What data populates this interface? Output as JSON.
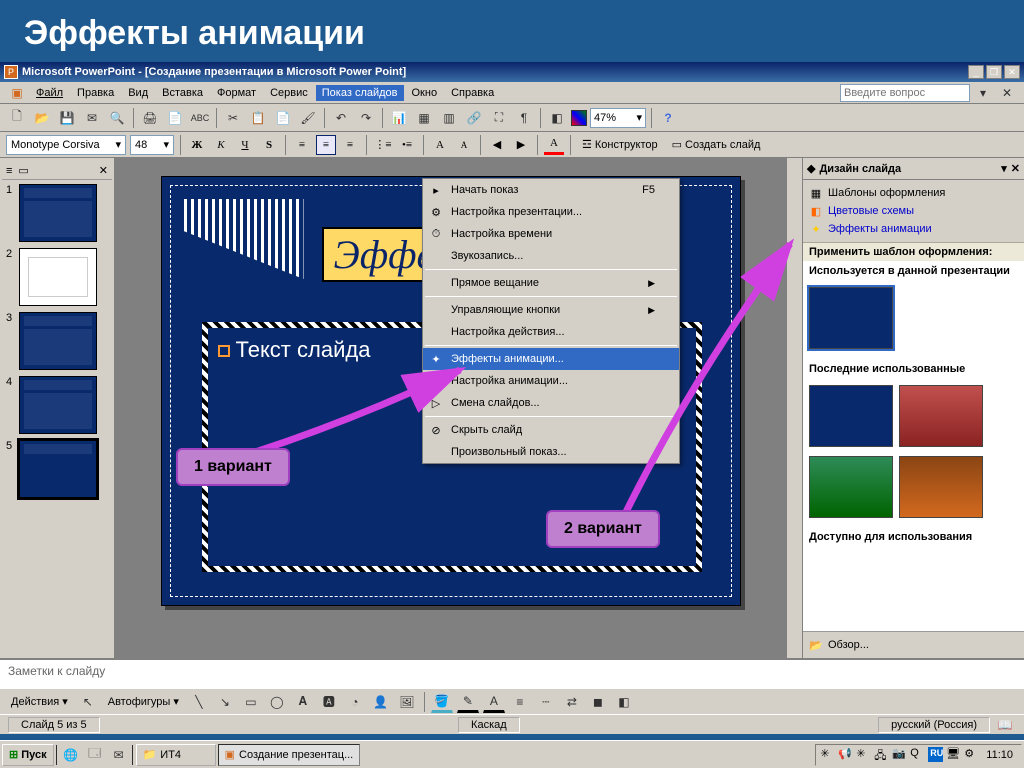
{
  "page_heading": "Эффекты анимации",
  "titlebar": "Microsoft PowerPoint - [Создание презентации в Microsoft Power Point]",
  "menu": {
    "file": "Файл",
    "edit": "Правка",
    "view": "Вид",
    "insert": "Вставка",
    "format": "Формат",
    "tools": "Сервис",
    "slideshow": "Показ слайдов",
    "window": "Окно",
    "help": "Справка"
  },
  "help_placeholder": "Введите вопрос",
  "zoom": "47%",
  "font": {
    "name": "Monotype Corsiva",
    "size": "48"
  },
  "toolbar2": {
    "designer": "Конструктор",
    "new_slide": "Создать слайд"
  },
  "dropdown": {
    "start": "Начать показ",
    "start_kbd": "F5",
    "setup": "Настройка презентации...",
    "rehearse": "Настройка времени",
    "record": "Звукозапись...",
    "broadcast": "Прямое вещание",
    "actionbtn": "Управляющие кнопки",
    "actionset": "Настройка действия...",
    "animscheme": "Эффекты анимации...",
    "customanim": "Настройка анимации...",
    "transition": "Смена слайдов...",
    "hide": "Скрыть слайд",
    "customshow": "Произвольный показ..."
  },
  "slide": {
    "title_frag": "Эффе",
    "body": "Текст слайда"
  },
  "callouts": {
    "v1": "1 вариант",
    "v2": "2 вариант"
  },
  "taskpane": {
    "title": "Дизайн слайда",
    "templates": "Шаблоны оформления",
    "colors": "Цветовые схемы",
    "anim": "Эффекты анимации",
    "apply": "Применить шаблон оформления:",
    "used": "Используется в данной презентации",
    "recent": "Последние использованные",
    "available": "Доступно для использования",
    "browse": "Обзор..."
  },
  "notes": "Заметки к слайду",
  "drawbar": {
    "actions": "Действия",
    "autoshapes": "Автофигуры"
  },
  "status": {
    "slide": "Слайд 5 из 5",
    "layout": "Каскад",
    "lang": "русский (Россия)"
  },
  "taskbar": {
    "start": "Пуск",
    "folder": "ИТ4",
    "app": "Создание презентац...",
    "lang": "RU",
    "clock": "11:10"
  }
}
